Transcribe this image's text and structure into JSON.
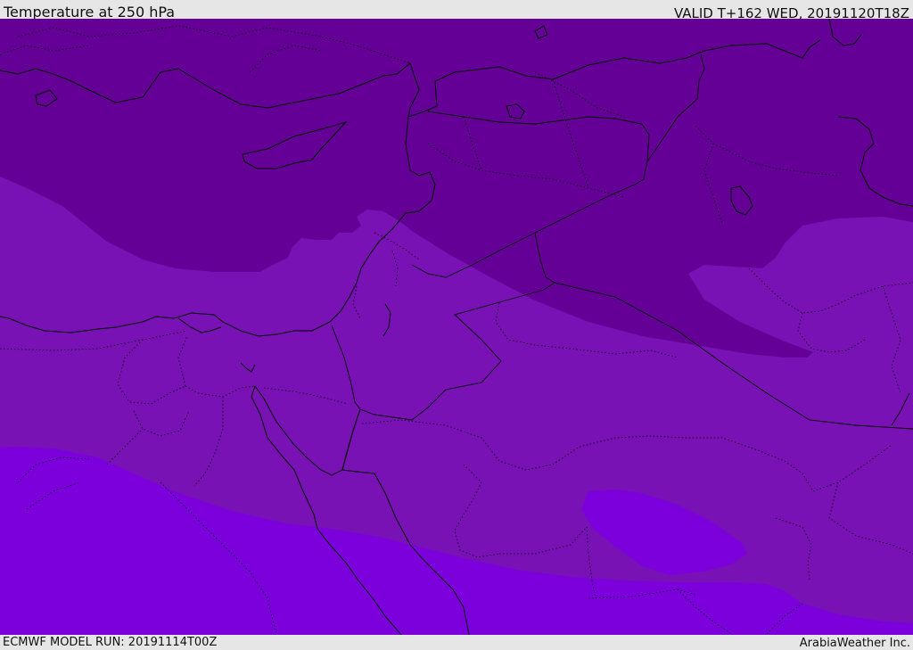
{
  "header": {
    "title": "Temperature at 250 hPa",
    "valid": "VALID T+162 WED, 20191120T18Z"
  },
  "footer": {
    "model_run": "ECMWF MODEL RUN: 20191114T00Z",
    "credit": "ArabiaWeather Inc."
  },
  "map": {
    "region": "Eastern Mediterranean / Middle East",
    "temperature_bands": [
      {
        "band": "coldest",
        "color": "#640096"
      },
      {
        "band": "middle",
        "color": "#7812b4"
      },
      {
        "band": "warmest",
        "color": "#7b00dc"
      }
    ],
    "coastline_color": "#000000",
    "border_style": "solid",
    "province_border_style": "dotted"
  }
}
